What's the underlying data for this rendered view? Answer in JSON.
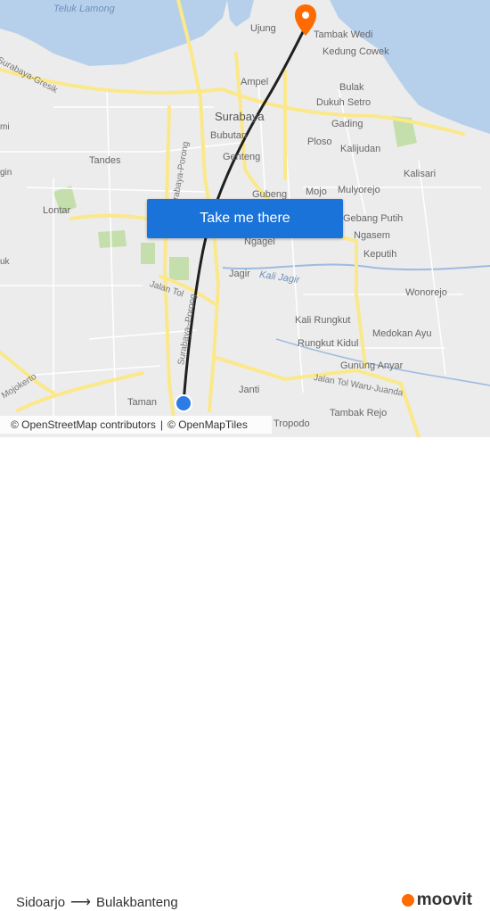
{
  "map": {
    "labels": {
      "teluk_lamong": "Teluk Lamong",
      "ujung": "Ujung",
      "tambak_wedi": "Tambak Wedi",
      "kedung_cowek": "Kedung Cowek",
      "surabaya_gresik": "Surabaya-Gresik",
      "ampel": "Ampel",
      "bulak": "Bulak",
      "dukuh_setro": "Dukuh Setro",
      "surabaya": "Surabaya",
      "gading": "Gading",
      "bubutan": "Bubutan",
      "ploso": "Ploso",
      "kalijudan": "Kalijudan",
      "genteng": "Genteng",
      "tandes": "Tandes",
      "kalisari": "Kalisari",
      "surabaya_porong_top": "Surabaya-Porong",
      "gubeng": "Gubeng",
      "mojo": "Mojo",
      "mulyorejo": "Mulyorejo",
      "lontar": "Lontar",
      "gebang_putih": "Gebang Putih",
      "ngasem": "Ngasem",
      "ngagel": "Ngagel",
      "keputih": "Keputih",
      "jagir": "Jagir",
      "kali_jagir": "Kali Jagir",
      "wonorejo": "Wonorejo",
      "jalan_tol": "Jalan Tol",
      "surabaya_porong_bottom": "Surabaya–Porong",
      "kali_rungkut": "Kali Rungkut",
      "medokan_ayu": "Medokan Ayu",
      "rungkut_kidul": "Rungkut Kidul",
      "gunung_anyar": "Gunung Anyar",
      "mojokerto": "Mojokerto",
      "janti": "Janti",
      "jalan_tol_waru_juanda": "Jalan Tol Waru-Juanda",
      "taman": "Taman",
      "tambak_rejo": "Tambak Rejo",
      "tropodo": "Tropodo",
      "edge_mi": "mi",
      "edge_gin": "gin",
      "edge_uk": "uk"
    },
    "markers": {
      "origin": "Sidoarjo",
      "destination": "Bulakbanteng"
    },
    "colors": {
      "sea": "#b6d0ec",
      "land": "#ececec",
      "route": "#1f1f1f",
      "origin": "#2d7be5",
      "destination": "#ff6b00",
      "major_road": "#fbe88a",
      "green": "#c5dfac"
    }
  },
  "cta": {
    "label": "Take me there"
  },
  "attribution": {
    "osm": "© OpenStreetMap contributors",
    "sep": "|",
    "omt": "© OpenMapTiles"
  },
  "footer": {
    "from": "Sidoarjo",
    "arrow": "⟶",
    "to": "Bulakbanteng",
    "brand": "moovit"
  }
}
